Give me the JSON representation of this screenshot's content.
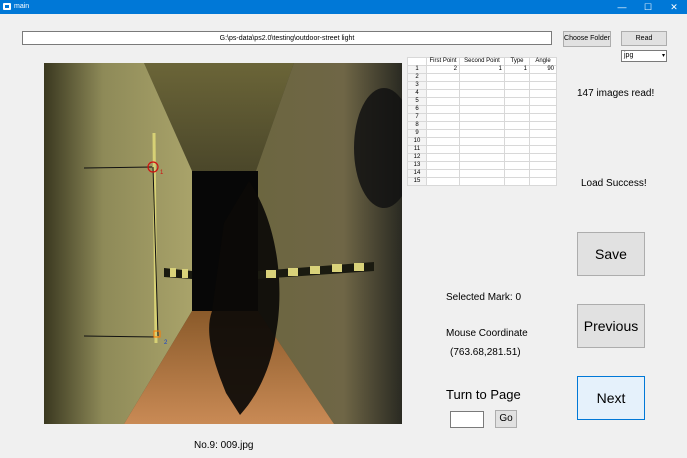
{
  "window": {
    "title": "main",
    "minimize": "—",
    "maximize": "☐",
    "close": "✕"
  },
  "path": {
    "value": "G:\\ps-data\\ps2.0\\testing\\outdoor-street light"
  },
  "buttons": {
    "choose_folder": "Choose Folder",
    "read": "Read",
    "save": "Save",
    "previous": "Previous",
    "next": "Next",
    "go": "Go"
  },
  "format_select": {
    "value": "jpg"
  },
  "table": {
    "headers": [
      "",
      "First Point",
      "Second Point",
      "Type",
      "Angle"
    ],
    "rows": [
      [
        "1",
        "2",
        "1",
        "1",
        "90"
      ],
      [
        "2",
        "",
        "",
        "",
        ""
      ],
      [
        "3",
        "",
        "",
        "",
        ""
      ],
      [
        "4",
        "",
        "",
        "",
        ""
      ],
      [
        "5",
        "",
        "",
        "",
        ""
      ],
      [
        "6",
        "",
        "",
        "",
        ""
      ],
      [
        "7",
        "",
        "",
        "",
        ""
      ],
      [
        "8",
        "",
        "",
        "",
        ""
      ],
      [
        "9",
        "",
        "",
        "",
        ""
      ],
      [
        "10",
        "",
        "",
        "",
        ""
      ],
      [
        "11",
        "",
        "",
        "",
        ""
      ],
      [
        "12",
        "",
        "",
        "",
        ""
      ],
      [
        "13",
        "",
        "",
        "",
        ""
      ],
      [
        "14",
        "",
        "",
        "",
        ""
      ],
      [
        "15",
        "",
        "",
        "",
        ""
      ]
    ]
  },
  "status": {
    "images_read": "147 images read!",
    "load": "Load Success!"
  },
  "info": {
    "selected_mark": "Selected Mark:  0",
    "mouse_coordinate_label": "Mouse Coordinate",
    "mouse_coordinate_value": "(763.68,281.51)",
    "turn_to_page": "Turn to Page",
    "page_input": ""
  },
  "image_caption": "No.9: 009.jpg",
  "image_markers": {
    "point_1": "1",
    "point_2": "2"
  }
}
